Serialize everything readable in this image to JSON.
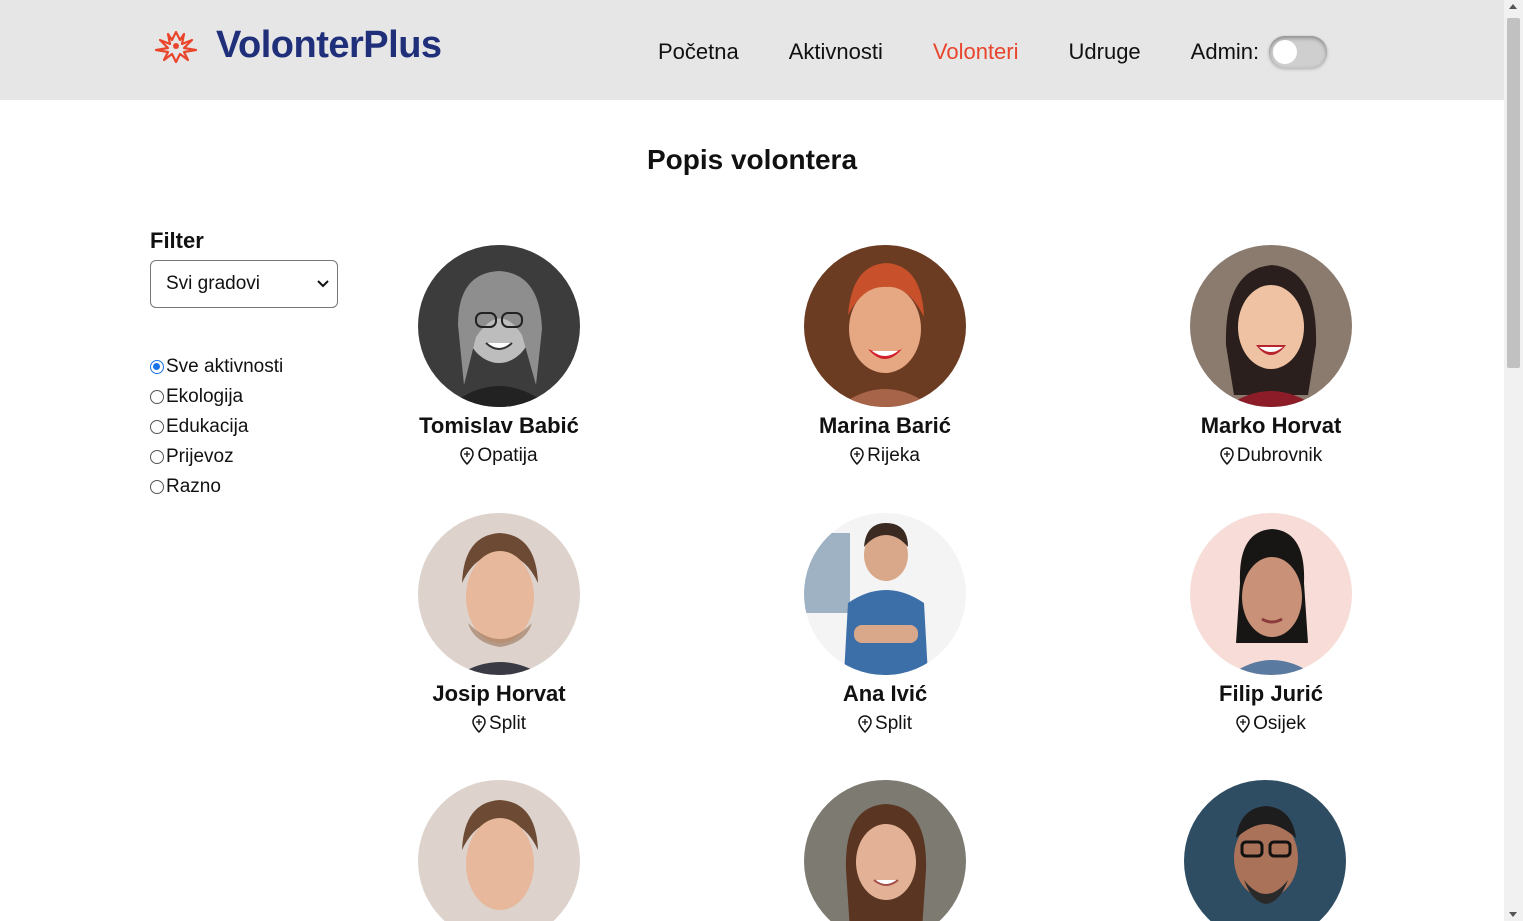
{
  "header": {
    "logo_text": "VolonterPlus",
    "nav": [
      "Početna",
      "Aktivnosti",
      "Volonteri",
      "Udruge"
    ],
    "active_nav": "Volonteri",
    "admin_label": "Admin:"
  },
  "page_title": "Popis volontera",
  "filter": {
    "title": "Filter",
    "city_select_value": "Svi gradovi",
    "activities": [
      "Sve aktivnosti",
      "Ekologija",
      "Edukacija",
      "Prijevoz",
      "Razno"
    ],
    "selected_activity": "Sve aktivnosti"
  },
  "volunteers": [
    {
      "name": "Tomislav Babić",
      "city": "Opatija"
    },
    {
      "name": "Marina Barić",
      "city": "Rijeka"
    },
    {
      "name": "Marko Horvat",
      "city": "Dubrovnik"
    },
    {
      "name": "Josip Horvat",
      "city": "Split"
    },
    {
      "name": "Ana Ivić",
      "city": "Split"
    },
    {
      "name": "Filip Jurić",
      "city": "Osijek"
    },
    {
      "name": "",
      "city": ""
    },
    {
      "name": "",
      "city": ""
    },
    {
      "name": "",
      "city": ""
    }
  ],
  "colors": {
    "brand": "#1f2f7a",
    "accent": "#e8452c",
    "header_bg": "#e6e6e6"
  }
}
